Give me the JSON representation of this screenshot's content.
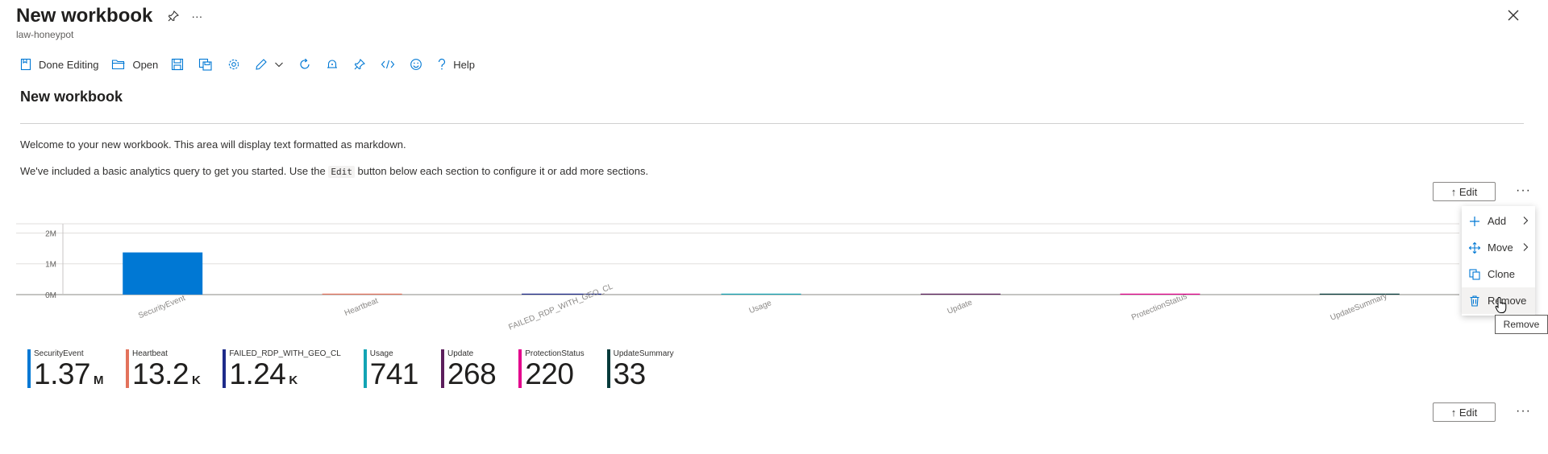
{
  "header": {
    "title": "New workbook",
    "subtitle": "law-honeypot",
    "more": "···"
  },
  "toolbar": {
    "done_editing": "Done Editing",
    "open": "Open",
    "help": "Help"
  },
  "section": {
    "title": "New workbook",
    "p1": "Welcome to your new workbook. This area will display text formatted as markdown.",
    "p2_before": "We've included a basic analytics query to get you started. Use the",
    "p2_code": "Edit",
    "p2_after": "button below each section to configure it or add more sections."
  },
  "edit_label": "↑ Edit",
  "more_label": "···",
  "chart_data": {
    "type": "bar",
    "categories": [
      "SecurityEvent",
      "Heartbeat",
      "FAILED_RDP_WITH_GEO_CL",
      "Usage",
      "Update",
      "ProtectionStatus",
      "UpdateSummary"
    ],
    "values": [
      1370000,
      13200,
      1240,
      741,
      268,
      220,
      33
    ],
    "ytick_labels": [
      "0M",
      "1M",
      "2M"
    ],
    "ylim": [
      0,
      2300000
    ],
    "bar_colors": [
      "#0078d4",
      "#e3725c",
      "#1e2b8a",
      "#13a4b4",
      "#5c1e5c",
      "#e3008c",
      "#063b3b"
    ],
    "grid": true
  },
  "tiles": [
    {
      "label": "SecurityEvent",
      "value": "1.37",
      "unit": "M",
      "color": "#0078d4"
    },
    {
      "label": "Heartbeat",
      "value": "13.2",
      "unit": "K",
      "color": "#e3725c"
    },
    {
      "label": "FAILED_RDP_WITH_GEO_CL",
      "value": "1.24",
      "unit": "K",
      "color": "#1e2b8a"
    },
    {
      "label": "Usage",
      "value": "741",
      "unit": "",
      "color": "#13a4b4"
    },
    {
      "label": "Update",
      "value": "268",
      "unit": "",
      "color": "#5c1e5c"
    },
    {
      "label": "ProtectionStatus",
      "value": "220",
      "unit": "",
      "color": "#e3008c"
    },
    {
      "label": "UpdateSummary",
      "value": "33",
      "unit": "",
      "color": "#063b3b"
    }
  ],
  "context_menu": {
    "items": [
      "Add",
      "Move",
      "Clone",
      "Remove"
    ]
  },
  "tooltip": "Remove",
  "accent_color": "#0078d4"
}
